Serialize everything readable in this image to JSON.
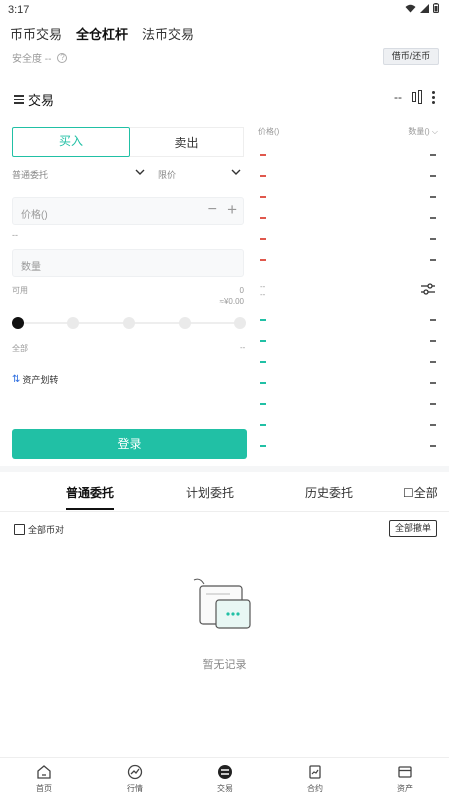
{
  "status_bar": {
    "time": "3:17"
  },
  "top_tabs": [
    {
      "label": "币币交易"
    },
    {
      "label": "全仓杠杆"
    },
    {
      "label": "法币交易"
    }
  ],
  "safety": {
    "label": "安全度 --"
  },
  "borrow_button": {
    "label": "借币/还币"
  },
  "trade_header": {
    "title": "交易",
    "ratio": "--"
  },
  "order_form": {
    "buy_label": "买入",
    "sell_label": "卖出",
    "order_type": "普通委托",
    "price_type": "限价",
    "price_placeholder": "价格()",
    "price_dash": "--",
    "qty_placeholder": "数量",
    "available_label": "可用",
    "available_value": "0",
    "available_sub": "≈¥0.00",
    "total_label": "全部",
    "total_dash": "--",
    "transfer_label": "资产划转",
    "login_label": "登录"
  },
  "order_book": {
    "price_header": "价格()",
    "qty_header": "数量() ⌵",
    "mid_top": "--",
    "mid_bottom": "--"
  },
  "orders": {
    "tabs": [
      {
        "label": "普通委托"
      },
      {
        "label": "计划委托"
      },
      {
        "label": "历史委托"
      },
      {
        "label": "全部"
      }
    ],
    "all_pairs_label": "全部币对",
    "cancel_all_label": "全部撤单",
    "empty_text": "暂无记录"
  },
  "bottom_nav": [
    {
      "label": "首页",
      "icon": "home-icon"
    },
    {
      "label": "行情",
      "icon": "market-icon"
    },
    {
      "label": "交易",
      "icon": "trade-icon"
    },
    {
      "label": "合约",
      "icon": "contract-icon"
    },
    {
      "label": "资产",
      "icon": "assets-icon"
    }
  ],
  "colors": {
    "accent": "#21c0a5",
    "ask": "#e0584d",
    "bid": "#21c0a5"
  }
}
